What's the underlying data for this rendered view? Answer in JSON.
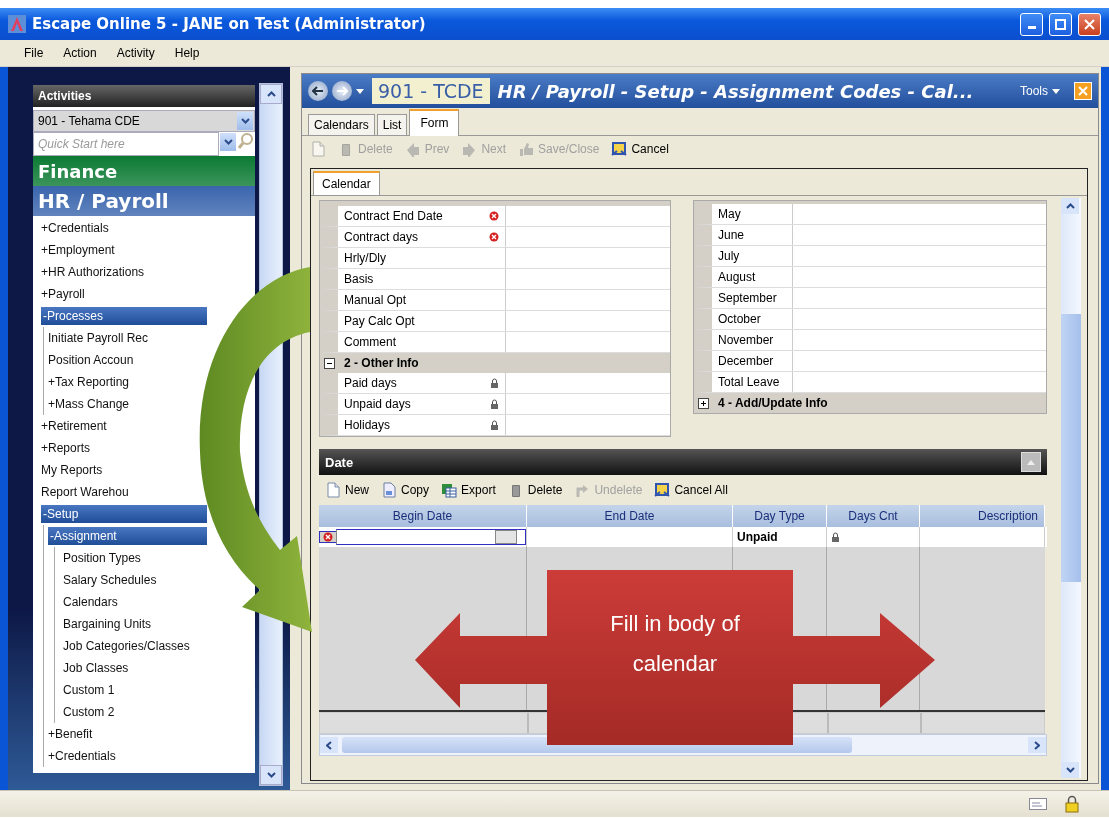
{
  "window": {
    "title": "Escape Online 5 - JANE on Test (Administrator)"
  },
  "menu": [
    "File",
    "Action",
    "Activity",
    "Help"
  ],
  "sidebar": {
    "title": "Activities",
    "district": "901 - Tehama CDE",
    "quick_start": {
      "placeholder": "Quick Start here"
    },
    "modules": [
      {
        "label": "Finance",
        "color": "#0b7a33"
      },
      {
        "label": "HR / Payroll",
        "color": "#3a65ad"
      }
    ],
    "items": [
      {
        "label": "+Credentials",
        "selected": false
      },
      {
        "label": "+Employment",
        "selected": false
      },
      {
        "label": "+HR Authorizations",
        "selected": false
      },
      {
        "label": "+Payroll",
        "selected": false
      },
      {
        "label": "-Processes",
        "selected": true,
        "children": [
          {
            "label": "Initiate Payroll Rec",
            "selected": false
          },
          {
            "label": "Position Accoun",
            "selected": false
          },
          {
            "label": "+Tax Reporting",
            "selected": false
          },
          {
            "label": "+Mass Change",
            "selected": false
          }
        ]
      },
      {
        "label": "+Retirement",
        "selected": false
      },
      {
        "label": "+Reports",
        "selected": false
      },
      {
        "label": "My Reports",
        "selected": false
      },
      {
        "label": "Report Warehou",
        "selected": false
      },
      {
        "label": "-Setup",
        "selected": true,
        "children": [
          {
            "label": "-Assignment",
            "selected": true,
            "children": [
              {
                "label": "Position Types",
                "selected": false
              },
              {
                "label": "Salary Schedules",
                "selected": false
              },
              {
                "label": "Calendars",
                "selected": false
              },
              {
                "label": "Bargaining Units",
                "selected": false
              },
              {
                "label": "Job Categories/Classes",
                "selected": false
              },
              {
                "label": "Job Classes",
                "selected": false
              },
              {
                "label": "Custom 1",
                "selected": false
              },
              {
                "label": "Custom 2",
                "selected": false
              }
            ]
          },
          {
            "label": "+Benefit",
            "selected": false
          },
          {
            "label": "+Credentials",
            "selected": false
          }
        ]
      }
    ]
  },
  "header": {
    "code": "901 - TCDE",
    "title": "HR / Payroll - Setup - Assignment Codes - Cal...",
    "tools": "Tools"
  },
  "tabs": [
    {
      "label": "Calendars",
      "selected": false
    },
    {
      "label": "List",
      "selected": false
    },
    {
      "label": "Form",
      "selected": true
    }
  ],
  "toolbar": [
    {
      "kind": "new",
      "disabled": true
    },
    {
      "kind": "delete",
      "label": "Delete",
      "disabled": true
    },
    {
      "kind": "prev",
      "label": "Prev",
      "disabled": true
    },
    {
      "kind": "next",
      "label": "Next",
      "disabled": true
    },
    {
      "kind": "save",
      "label": "Save/Close",
      "disabled": true
    },
    {
      "kind": "cancel",
      "label": "Cancel",
      "disabled": false
    }
  ],
  "form_tabs": [
    {
      "label": "Calendar",
      "selected": true
    }
  ],
  "left_grid": [
    {
      "label": "Contract End Date",
      "required_error": true
    },
    {
      "label": "Contract days",
      "required_error": true
    },
    {
      "label": "Hrly/Dly"
    },
    {
      "label": "Basis"
    },
    {
      "label": "Manual Opt"
    },
    {
      "label": "Pay Calc Opt"
    },
    {
      "label": "Comment"
    },
    {
      "kind": "group",
      "label": "2 - Other Info",
      "expanded": true
    },
    {
      "label": "Paid days",
      "locked": true
    },
    {
      "label": "Unpaid days",
      "locked": true
    },
    {
      "label": "Holidays",
      "locked": true
    }
  ],
  "right_grid": [
    {
      "label": "May"
    },
    {
      "label": "June"
    },
    {
      "label": "July"
    },
    {
      "label": "August"
    },
    {
      "label": "September"
    },
    {
      "label": "October"
    },
    {
      "label": "November"
    },
    {
      "label": "December"
    },
    {
      "label": "Total Leave"
    },
    {
      "kind": "group",
      "label": "4 - Add/Update Info",
      "expanded": false
    }
  ],
  "date_panel": {
    "title": "Date",
    "toolbar": [
      {
        "kind": "new",
        "label": "New",
        "disabled": false
      },
      {
        "kind": "copy",
        "label": "Copy",
        "disabled": false
      },
      {
        "kind": "export",
        "label": "Export",
        "disabled": false
      },
      {
        "kind": "delete",
        "label": "Delete",
        "disabled": false
      },
      {
        "kind": "undelete",
        "label": "Undelete",
        "disabled": true
      },
      {
        "kind": "cancel",
        "label": "Cancel All",
        "disabled": false
      }
    ],
    "columns": [
      "Begin Date",
      "End Date",
      "Day Type",
      "Days Cnt",
      "Description"
    ],
    "rows": [
      {
        "error": true,
        "day_type": "Unpaid",
        "days_locked": true
      }
    ]
  },
  "callout": {
    "text": "Fill in body of calendar"
  }
}
